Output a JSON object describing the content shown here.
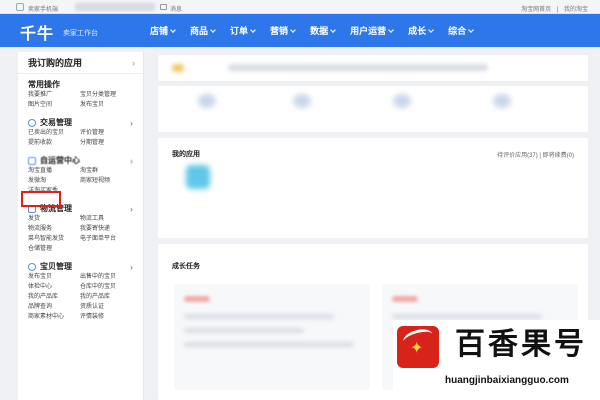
{
  "topbar": {
    "phone_label": "卖家手机端",
    "messages_label": "消息",
    "links": [
      "淘宝网首页",
      "|",
      "我的淘宝"
    ]
  },
  "header": {
    "brand": "千牛",
    "subtitle": "卖家工作台",
    "nav": [
      "店铺",
      "商品",
      "订单",
      "营销",
      "数据",
      "用户运营",
      "成长",
      "综合"
    ]
  },
  "sidebar": {
    "title": "我订购的应用",
    "sections": [
      {
        "title": "常用操作",
        "items": [
          "我要推广",
          "宝贝分类管理",
          "图片空间",
          "发布宝贝"
        ]
      },
      {
        "title": "交易管理",
        "items": [
          "已卖出的宝贝",
          "评价管理",
          "提前收款",
          "分期管理"
        ]
      },
      {
        "title": "自运营中心",
        "items": [
          "淘宝直播",
          "淘宝群",
          "发微淘",
          "商家短视频",
          "洋淘买家秀"
        ]
      },
      {
        "title": "物流管理",
        "items": [
          "发货",
          "物流工具",
          "物流服务",
          "我要寄快递",
          "菜鸟智能发货",
          "电子面单平台",
          "仓储管理"
        ]
      },
      {
        "title": "宝贝管理",
        "items": [
          "发布宝贝",
          "出售中的宝贝",
          "体检中心",
          "仓库中的宝贝",
          "我的产品库",
          "我的产品库",
          "品牌查询",
          "资质认证",
          "商家素材中心",
          "评情装修"
        ]
      }
    ]
  },
  "apps_card": {
    "title": "我的应用",
    "links": "待评价应用(37) | 即将续费(0)"
  },
  "growth_card": {
    "title": "成长任务"
  },
  "watermark": {
    "name": "百香果号",
    "url": "huangjinbaixiangguo.com"
  },
  "colors": {
    "header_blue": "#2e77ea",
    "highlight_red": "#e0201a",
    "logo_red": "#d8231a"
  }
}
